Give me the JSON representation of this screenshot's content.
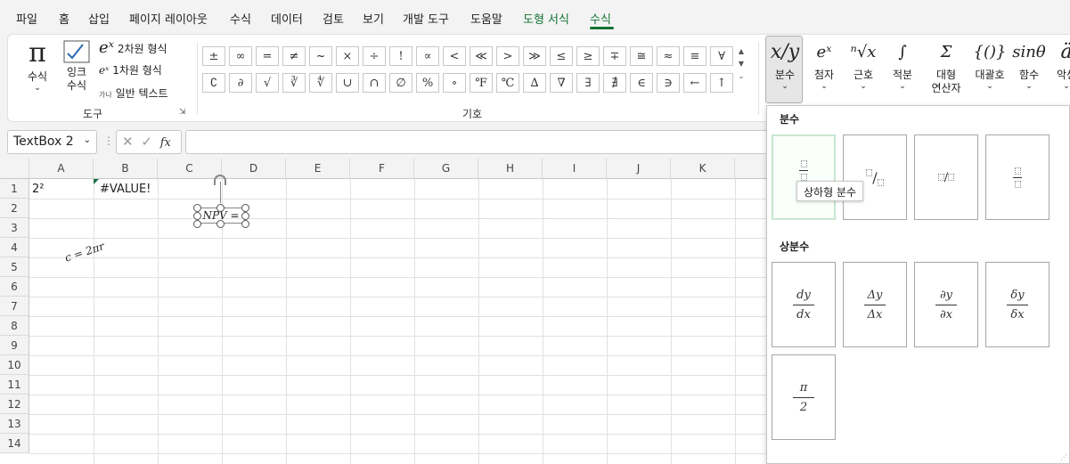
{
  "tabs": [
    {
      "label": "파일"
    },
    {
      "label": "홈"
    },
    {
      "label": "삽입"
    },
    {
      "label": "페이지 레이아웃"
    },
    {
      "label": "수식"
    },
    {
      "label": "데이터"
    },
    {
      "label": "검토"
    },
    {
      "label": "보기"
    },
    {
      "label": "개발 도구"
    },
    {
      "label": "도움말"
    },
    {
      "label": "도형 서식"
    },
    {
      "label": "수식"
    }
  ],
  "tools": {
    "equation_label": "수식",
    "ink_label": "잉크\n수식",
    "professional": "2차원 형식",
    "linear": "1차원 형식",
    "normal_text": "일반 텍스트",
    "normal_prefix": "가나",
    "group_label": "도구"
  },
  "symbols": {
    "group_label": "기호",
    "row1": [
      "±",
      "∞",
      "=",
      "≠",
      "~",
      "×",
      "÷",
      "!",
      "∝",
      "<",
      "≪",
      ">",
      "≫",
      "≤",
      "≥",
      "∓",
      "≅",
      "≈",
      "≡",
      "∀"
    ],
    "row2": [
      "∁",
      "∂",
      "√",
      "∛",
      "∜",
      "∪",
      "∩",
      "∅",
      "%",
      "∘",
      "℉",
      "℃",
      "∆",
      "∇",
      "∃",
      "∄",
      "∈",
      "∋",
      "←",
      "↑"
    ]
  },
  "structures": [
    {
      "label": "분수",
      "glyph": "x/y"
    },
    {
      "label": "첨자",
      "glyph": "eˣ"
    },
    {
      "label": "근호",
      "glyph": "ⁿ√x"
    },
    {
      "label": "적분",
      "glyph": "∫"
    },
    {
      "label": "대형\n연산자",
      "glyph": "Σ"
    },
    {
      "label": "대괄호",
      "glyph": "{()}"
    },
    {
      "label": "함수",
      "glyph": "sinθ"
    },
    {
      "label": "악센",
      "glyph": "ä"
    }
  ],
  "formula_bar": {
    "name_box": "TextBox 2",
    "fx": "fx",
    "value": ""
  },
  "sheet": {
    "columns": [
      "A",
      "B",
      "C",
      "D",
      "E",
      "F",
      "G",
      "H",
      "I",
      "J",
      "K"
    ],
    "rows": [
      "1",
      "2",
      "3",
      "4",
      "5",
      "6",
      "7",
      "8",
      "9",
      "10",
      "11",
      "12",
      "13",
      "14"
    ],
    "cells": {
      "A1": "2²",
      "B1": "#VALUE!"
    },
    "equation_textbox": "NPV =",
    "floating_equation": "c = 2πr"
  },
  "panel": {
    "section1": "분수",
    "section2": "상분수",
    "tooltip": "상하형 분수",
    "common": [
      {
        "num": "dy",
        "den": "dx"
      },
      {
        "num": "Δy",
        "den": "Δx"
      },
      {
        "num": "∂y",
        "den": "∂x"
      },
      {
        "num": "δy",
        "den": "δx"
      },
      {
        "num": "π",
        "den": "2"
      }
    ]
  }
}
